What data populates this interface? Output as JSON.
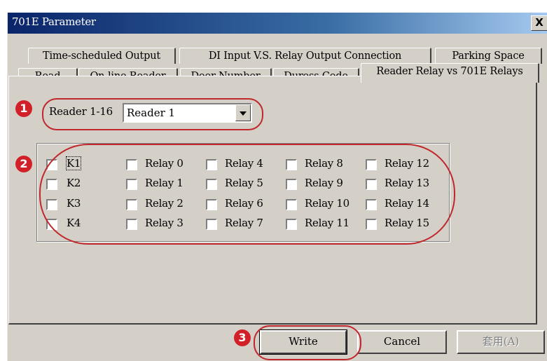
{
  "window": {
    "title": "701E Parameter",
    "close_label": "X"
  },
  "tabs_row1": [
    "Time-scheduled Output",
    "DI Input  V.S. Relay Output Connection",
    "Parking Space"
  ],
  "tabs_row2": [
    "Read",
    "On-line Reader",
    "Door Number",
    "Duress Code",
    "Reader Relay vs 701E Relays"
  ],
  "reader": {
    "label": "Reader 1-16",
    "selected": "Reader 1"
  },
  "k_items": [
    "K1",
    "K2",
    "K3",
    "K4"
  ],
  "relays": [
    [
      "Relay 0",
      "Relay 1",
      "Relay 2",
      "Relay 3"
    ],
    [
      "Relay 4",
      "Relay 5",
      "Relay 6",
      "Relay 7"
    ],
    [
      "Relay 8",
      "Relay 9",
      "Relay 10",
      "Relay 11"
    ],
    [
      "Relay 12",
      "Relay 13",
      "Relay 14",
      "Relay 15"
    ]
  ],
  "buttons": {
    "write": "Write",
    "cancel": "Cancel",
    "apply": "套用(A)"
  },
  "markers": [
    "1",
    "2",
    "3"
  ],
  "colors": {
    "annotation": "#c0282d",
    "title_bar": "#0a246a"
  }
}
